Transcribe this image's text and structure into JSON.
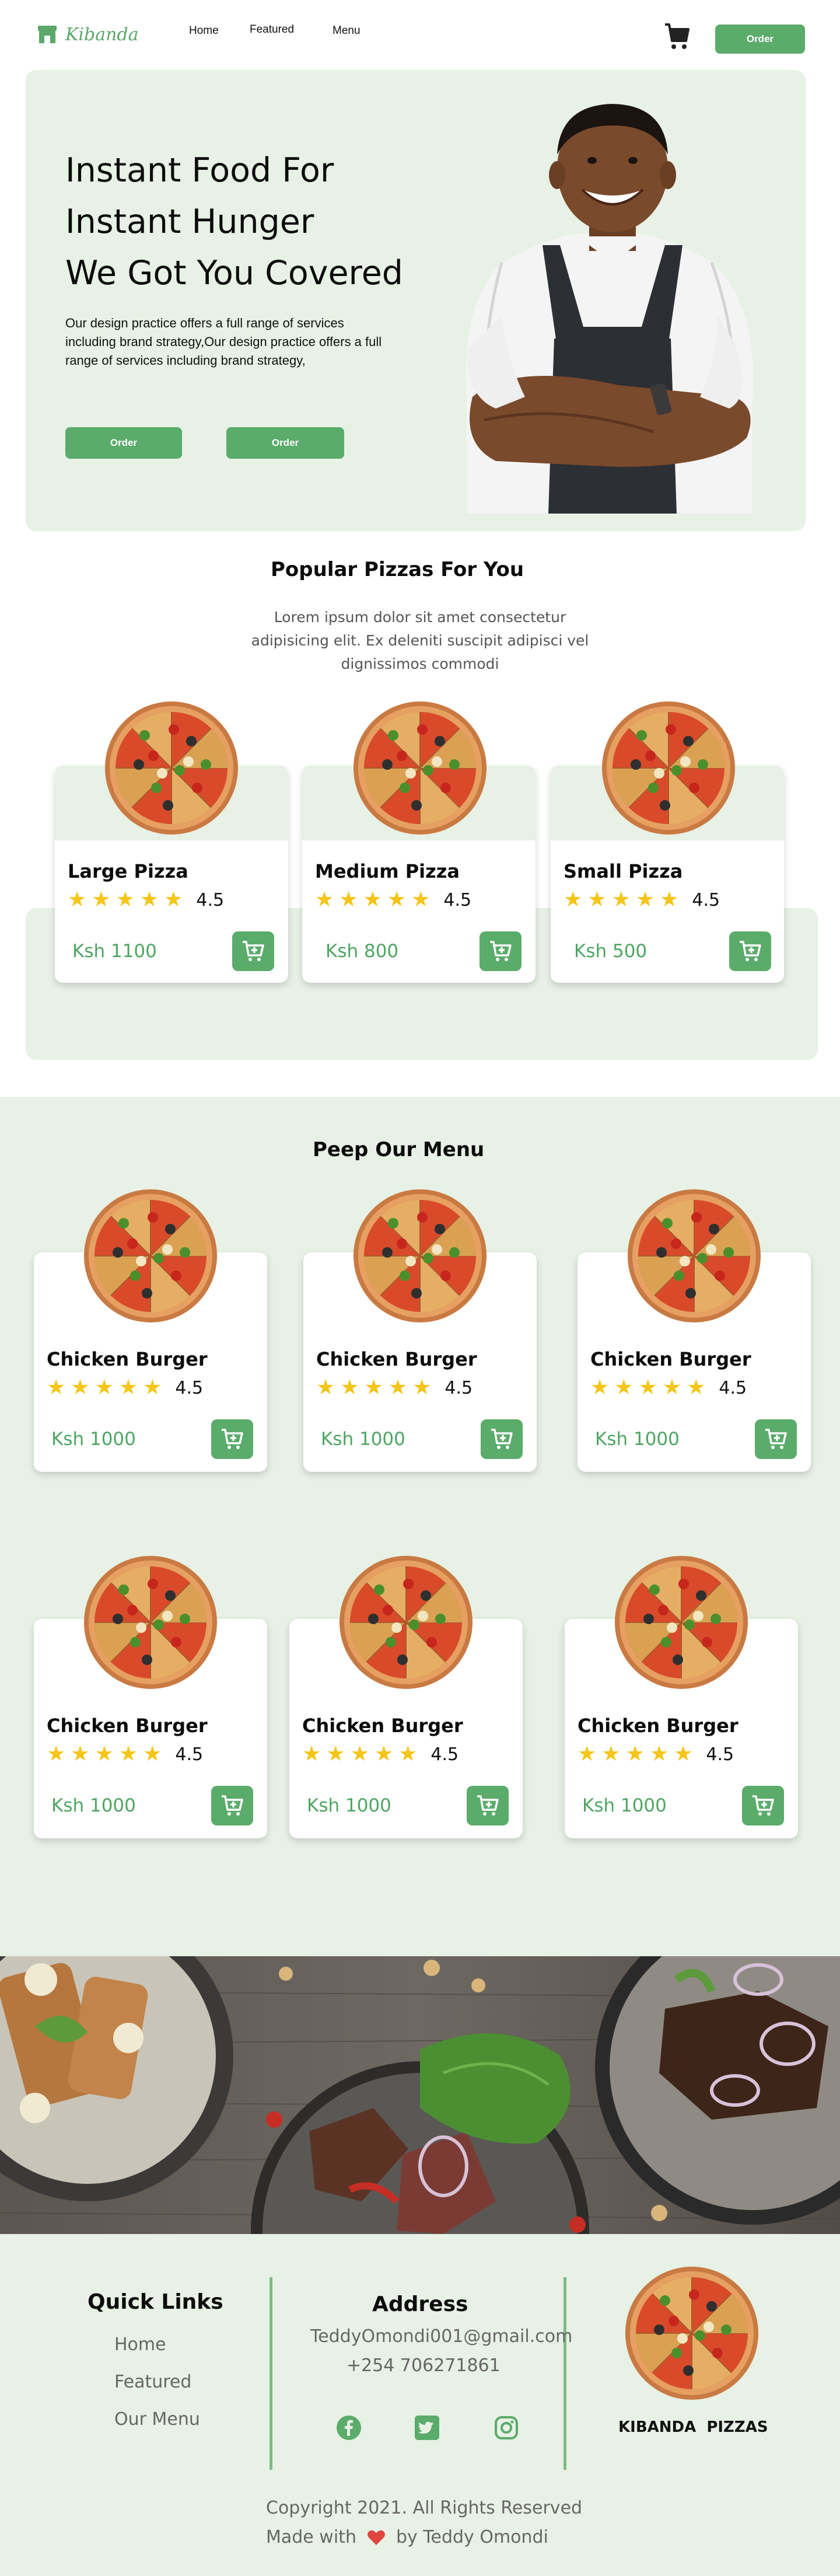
{
  "brand": {
    "name": "Kibanda",
    "color": "#5aa86a"
  },
  "nav": {
    "links": [
      "Home",
      "Featured",
      "Menu"
    ],
    "order_label": "Order"
  },
  "hero": {
    "title_lines": [
      "Instant Food For",
      "Instant Hunger",
      "We Got You Covered"
    ],
    "description": "Our design practice offers a full range of services including brand strategy,Our design practice offers a full range of services including brand strategy,",
    "buttons": [
      "Order",
      "Order"
    ]
  },
  "popular": {
    "title": "Popular  Pizzas For You",
    "subtitle": "Lorem ipsum dolor sit amet consectetur adipisicing elit. Ex deleniti suscipit adipisci vel dignissimos commodi",
    "items": [
      {
        "name": "Large  Pizza",
        "rating": "4.5",
        "price": "Ksh 1100"
      },
      {
        "name": "Medium Pizza",
        "rating": "4.5",
        "price": "Ksh 800"
      },
      {
        "name": "Small Pizza",
        "rating": "4.5",
        "price": "Ksh 500"
      }
    ]
  },
  "menu": {
    "title": "Peep Our Menu",
    "items": [
      {
        "name": "Chicken Burger",
        "rating": "4.5",
        "price": "Ksh 1000"
      },
      {
        "name": "Chicken Burger",
        "rating": "4.5",
        "price": "Ksh 1000"
      },
      {
        "name": "Chicken Burger",
        "rating": "4.5",
        "price": "Ksh 1000"
      },
      {
        "name": "Chicken Burger",
        "rating": "4.5",
        "price": "Ksh 1000"
      },
      {
        "name": "Chicken Burger",
        "rating": "4.5",
        "price": "Ksh 1000"
      },
      {
        "name": "Chicken Burger",
        "rating": "4.5",
        "price": "Ksh 1000"
      }
    ]
  },
  "footer": {
    "quick_links_title": "Quick Links",
    "quick_links": [
      "Home",
      "Featured",
      "Our Menu"
    ],
    "address_title": "Address",
    "email": "TeddyOmondi001@gmail.com",
    "phone": "+254 706271861",
    "social_icons": [
      "facebook-icon",
      "twitter-icon",
      "instagram-icon"
    ],
    "brand_caption": "KIBANDA  PIZZAS",
    "copyright": "Copyright 2021. All Rights Reserved",
    "made_with": "Made with",
    "by": "by Teddy Omondi"
  },
  "colors": {
    "accent": "#5bab6b",
    "light_green": "#e7f1e5",
    "star": "#f5c518",
    "heart": "#e0463f"
  }
}
